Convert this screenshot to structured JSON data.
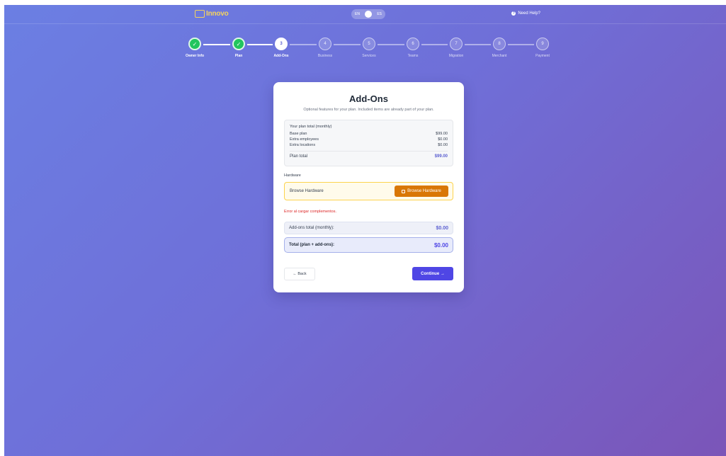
{
  "header": {
    "logo_text": "Innovo",
    "lang_left": "EN",
    "lang_right": "ES",
    "help_icon_glyph": "?",
    "help_text": "Need Help?"
  },
  "stepper": {
    "done_glyph": "✓",
    "steps": [
      {
        "number": "1",
        "label": "Owner Info",
        "state": "done"
      },
      {
        "number": "2",
        "label": "Plan",
        "state": "done"
      },
      {
        "number": "3",
        "label": "Add-Ons",
        "state": "active"
      },
      {
        "number": "4",
        "label": "Business",
        "state": "pending"
      },
      {
        "number": "5",
        "label": "Services",
        "state": "pending"
      },
      {
        "number": "6",
        "label": "Teams",
        "state": "pending"
      },
      {
        "number": "7",
        "label": "Migration",
        "state": "pending"
      },
      {
        "number": "8",
        "label": "Merchant",
        "state": "pending"
      },
      {
        "number": "9",
        "label": "Payment",
        "state": "pending"
      }
    ]
  },
  "card": {
    "title": "Add-Ons",
    "subtitle": "Optional features for your plan. Included items are already part of your plan.",
    "plan_summary": {
      "heading": "Your plan total (monthly)",
      "rows": [
        {
          "label": "Base plan",
          "value": "$99.00"
        },
        {
          "label": "Extra employees",
          "value": "$0.00"
        },
        {
          "label": "Extra locations",
          "value": "$0.00"
        }
      ],
      "total_label": "Plan total",
      "total_value": "$99.00"
    },
    "hardware": {
      "section_label": "Hardware",
      "row_text": "Browse Hardware",
      "button_label": "Browse Hardware"
    },
    "error_text": "Error al cargar complementos.",
    "addons_total_label": "Add-ons total (monthly):",
    "addons_total_value": "$0.00",
    "grand_total_label": "Total (plan + add-ons):",
    "grand_total_value": "$0.00",
    "back_label": "← Back",
    "continue_label": "Continue →"
  },
  "colors": {
    "accent": "#4f46e5",
    "success": "#22c55e",
    "warning_button": "#d97706",
    "error": "#dc2626"
  }
}
